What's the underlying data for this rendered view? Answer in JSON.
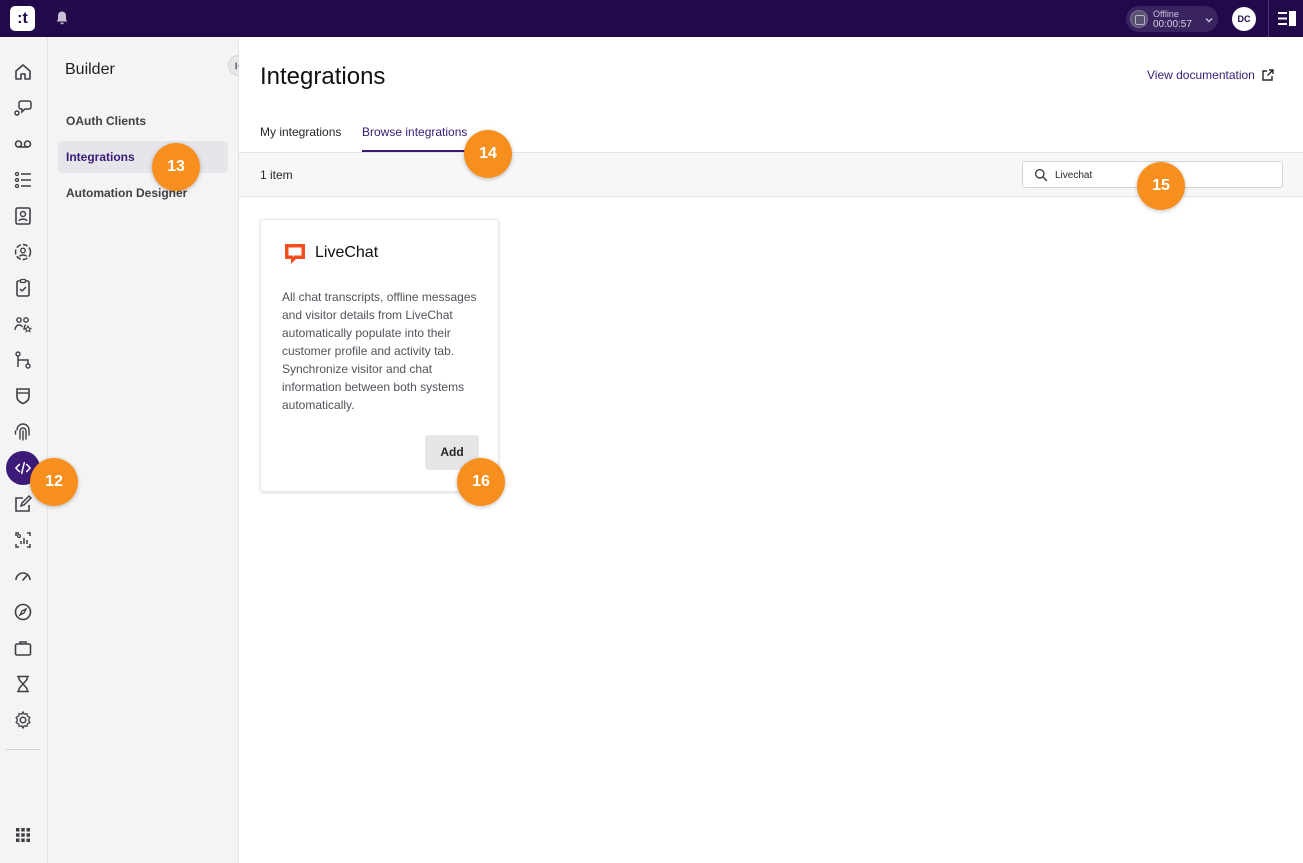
{
  "topbar": {
    "logo_text": ":t",
    "status_label": "Offline",
    "status_time": "00:00:57",
    "avatar_initials": "DC"
  },
  "rail": {
    "icons": [
      "home-icon",
      "chat-icon",
      "voicemail-icon",
      "task-list-icon",
      "contacts-icon",
      "agent-icon",
      "clipboard-icon",
      "team-icon",
      "routing-icon",
      "shield-icon",
      "fingerprint-icon",
      "code-icon",
      "edit-icon",
      "analytics-icon",
      "gauge-icon",
      "compass-icon",
      "briefcase-icon",
      "hourglass-icon",
      "settings-icon",
      "apps-grid-icon"
    ],
    "active": "code-icon"
  },
  "subnav": {
    "title": "Builder",
    "items": [
      {
        "label": "OAuth Clients"
      },
      {
        "label": "Integrations"
      },
      {
        "label": "Automation Designer"
      }
    ]
  },
  "main": {
    "title": "Integrations",
    "doc_link": "View documentation",
    "tabs": [
      {
        "label": "My integrations"
      },
      {
        "label": "Browse integrations"
      }
    ],
    "item_count": "1 item",
    "search": {
      "value": "Livechat"
    },
    "cards": [
      {
        "title": "LiveChat",
        "description": "All chat transcripts, offline messages and visitor details from LiveChat automatically populate into their customer profile and activity tab. Synchronize visitor and chat information between both systems automatically.",
        "button": "Add"
      }
    ]
  },
  "markers": [
    "12",
    "13",
    "14",
    "15",
    "16"
  ],
  "colors": {
    "topbar": "#22094a",
    "accent": "#3b1a78",
    "marker": "#f78f1e",
    "livechat": "#f24e1e"
  }
}
